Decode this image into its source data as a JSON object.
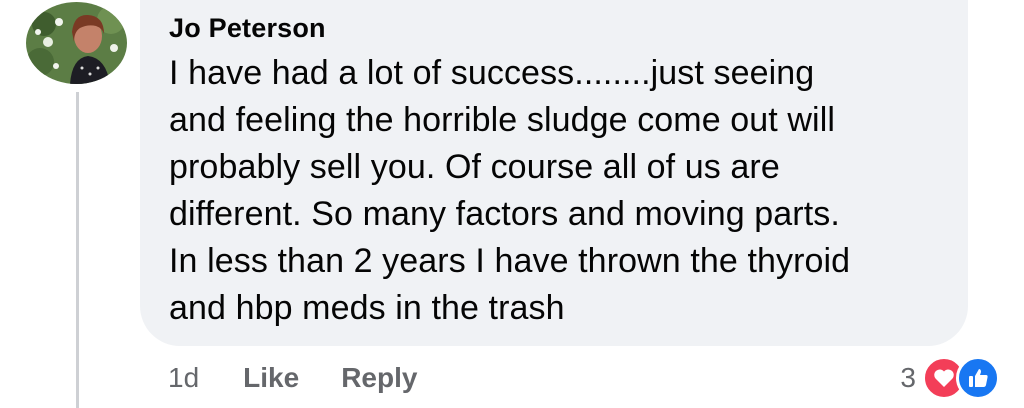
{
  "comment": {
    "author": "Jo Peterson",
    "lines": [
      "I have had a lot of success........just seeing",
      "and feeling the horrible sludge come out will",
      "probably sell you. Of course all of us are",
      "different. So many factors and moving parts.",
      "In less than 2 years I have thrown the thyroid",
      "and hbp meds in the trash"
    ],
    "timestamp": "1d",
    "like_label": "Like",
    "reply_label": "Reply",
    "reaction_count": "3",
    "reactions": [
      "love-icon",
      "like-icon"
    ]
  },
  "colors": {
    "bubble": "#f0f2f5",
    "meta_text": "#65676b",
    "love": "#f33e58",
    "like": "#1877f2",
    "thread_line": "#ced0d4"
  }
}
